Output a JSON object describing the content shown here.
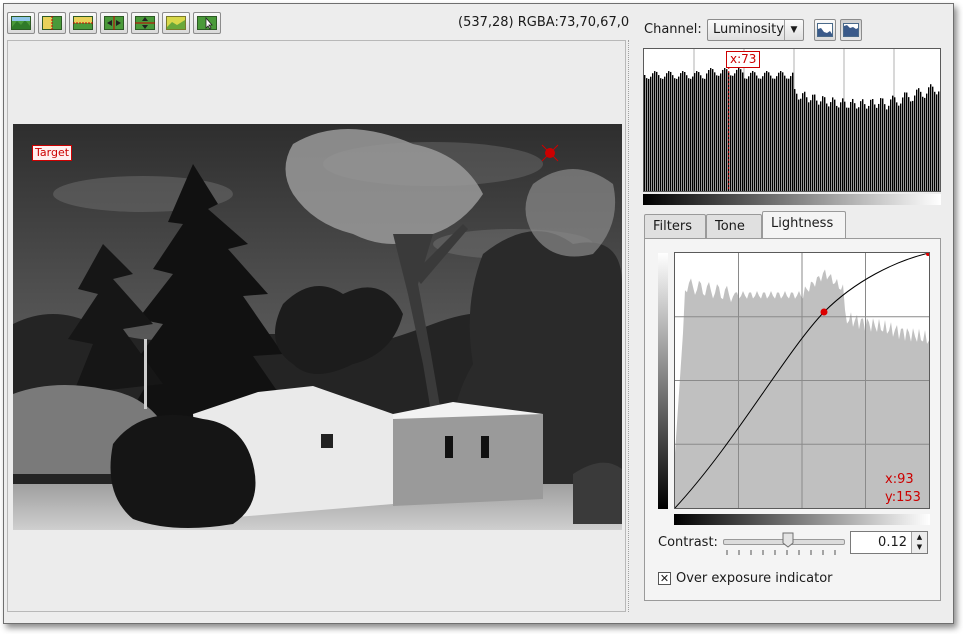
{
  "toolbar": {
    "buttons": [
      {
        "name": "image-icon"
      },
      {
        "name": "vertical-split-icon"
      },
      {
        "name": "horizontal-split-icon"
      },
      {
        "name": "move-horizontal-icon"
      },
      {
        "name": "move-vertical-icon"
      },
      {
        "name": "preview-highlight-icon"
      },
      {
        "name": "target-picker-icon"
      }
    ]
  },
  "status": {
    "cursor_info": "(537,28) RGBA:73,70,67,0"
  },
  "canvas": {
    "target_label": "Target"
  },
  "channel": {
    "label": "Channel:",
    "selected": "Luminosity",
    "linear_icon": "linear-histogram-icon",
    "log_icon": "log-histogram-icon"
  },
  "histogram": {
    "marker_label": "x:73"
  },
  "tabs": [
    {
      "label": "Filters",
      "active": false
    },
    {
      "label": "Tone",
      "active": false
    },
    {
      "label": "Lightness",
      "active": true
    }
  ],
  "curve": {
    "x_readout": "x:93",
    "y_readout": "y:153"
  },
  "contrast": {
    "label": "Contrast:",
    "value": "0.12",
    "slider_level": 0.6
  },
  "overexposure": {
    "label": "Over exposure indicator",
    "checked": true
  },
  "colors": {
    "accent_red": "#cc0000"
  }
}
